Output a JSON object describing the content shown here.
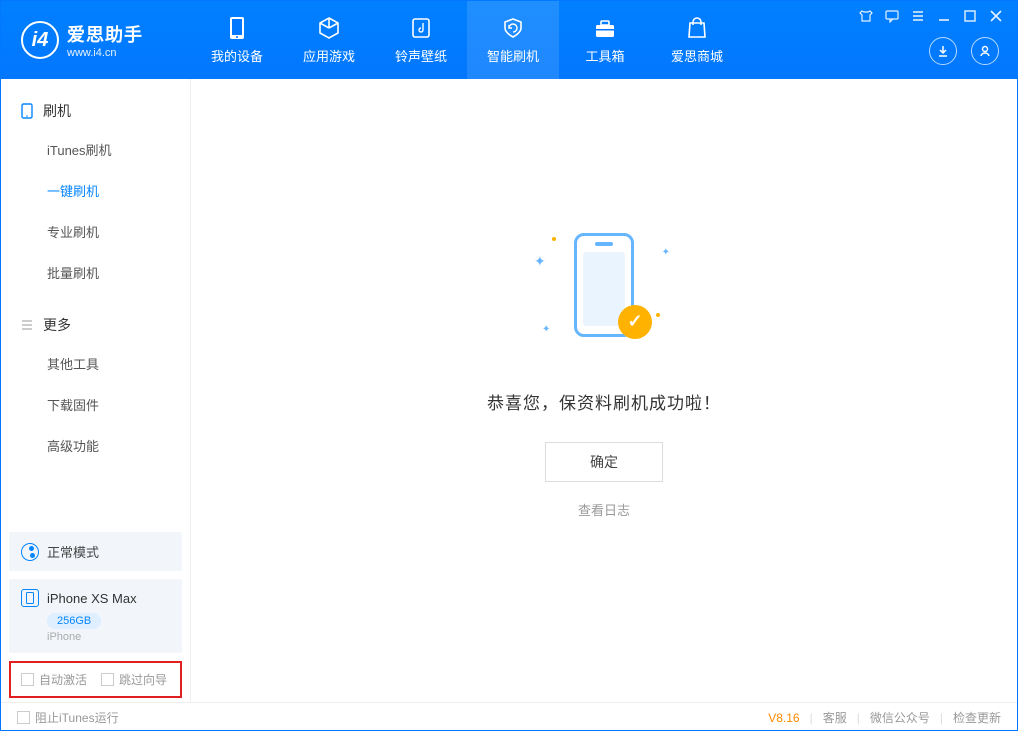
{
  "app": {
    "title": "爱思助手",
    "url": "www.i4.cn"
  },
  "nav": {
    "tabs": [
      {
        "label": "我的设备"
      },
      {
        "label": "应用游戏"
      },
      {
        "label": "铃声壁纸"
      },
      {
        "label": "智能刷机"
      },
      {
        "label": "工具箱"
      },
      {
        "label": "爱思商城"
      }
    ]
  },
  "sidebar": {
    "section1": {
      "title": "刷机",
      "items": [
        {
          "label": "iTunes刷机"
        },
        {
          "label": "一键刷机"
        },
        {
          "label": "专业刷机"
        },
        {
          "label": "批量刷机"
        }
      ]
    },
    "section2": {
      "title": "更多",
      "items": [
        {
          "label": "其他工具"
        },
        {
          "label": "下载固件"
        },
        {
          "label": "高级功能"
        }
      ]
    },
    "mode": "正常模式",
    "device": {
      "name": "iPhone XS Max",
      "storage": "256GB",
      "type": "iPhone"
    },
    "options": {
      "auto_activate": "自动激活",
      "skip_guide": "跳过向导"
    }
  },
  "main": {
    "success_text": "恭喜您，保资料刷机成功啦！",
    "ok_button": "确定",
    "view_log": "查看日志"
  },
  "footer": {
    "prevent_itunes": "阻止iTunes运行",
    "version": "V8.16",
    "support": "客服",
    "wechat": "微信公众号",
    "check_update": "检查更新"
  }
}
